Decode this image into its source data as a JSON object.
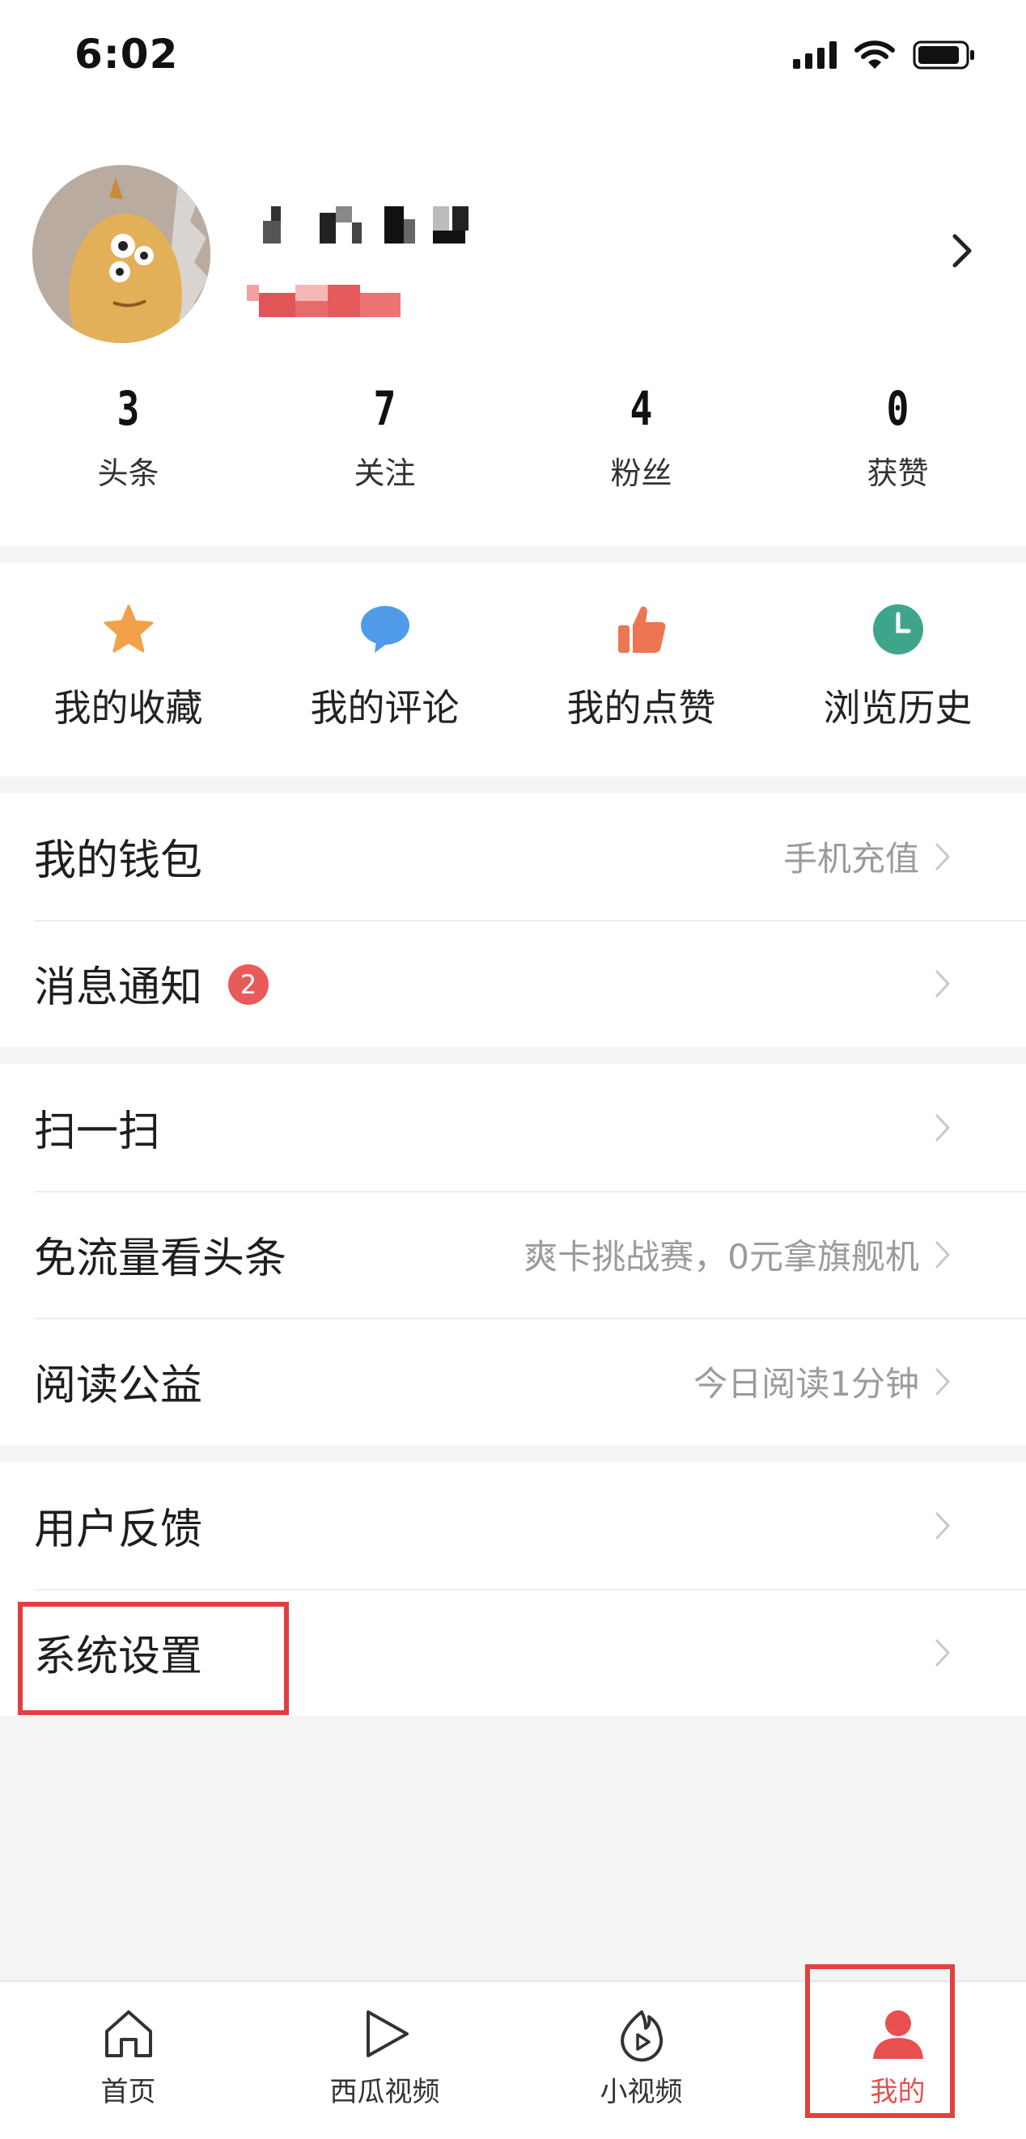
{
  "status_bar": {
    "time": "6:02"
  },
  "profile": {
    "stats": [
      {
        "value": "3",
        "label": "头条"
      },
      {
        "value": "7",
        "label": "关注"
      },
      {
        "value": "4",
        "label": "粉丝"
      },
      {
        "value": "0",
        "label": "获赞"
      }
    ]
  },
  "quick_actions": [
    {
      "label": "我的收藏",
      "icon": "star-icon",
      "color": "#f3a04b"
    },
    {
      "label": "我的评论",
      "icon": "comment-icon",
      "color": "#4f9be8"
    },
    {
      "label": "我的点赞",
      "icon": "thumbs-up-icon",
      "color": "#ed7552"
    },
    {
      "label": "浏览历史",
      "icon": "clock-icon",
      "color": "#3fa58a"
    }
  ],
  "menu": {
    "group1": [
      {
        "label": "我的钱包",
        "right": "手机充值"
      },
      {
        "label": "消息通知",
        "badge": "2",
        "right": ""
      }
    ],
    "group2": [
      {
        "label": "扫一扫",
        "right": ""
      },
      {
        "label": "免流量看头条",
        "right": "爽卡挑战赛，0元拿旗舰机"
      },
      {
        "label": "阅读公益",
        "right": "今日阅读1分钟"
      }
    ],
    "group3": [
      {
        "label": "用户反馈",
        "right": ""
      },
      {
        "label": "系统设置",
        "right": ""
      }
    ]
  },
  "tabs": [
    {
      "label": "首页",
      "icon": "home-icon"
    },
    {
      "label": "西瓜视频",
      "icon": "play-icon"
    },
    {
      "label": "小视频",
      "icon": "short-video-icon"
    },
    {
      "label": "我的",
      "icon": "person-icon",
      "active": true
    }
  ],
  "colors": {
    "accent": "#e84f4f",
    "highlight_box": "#e0403f"
  }
}
